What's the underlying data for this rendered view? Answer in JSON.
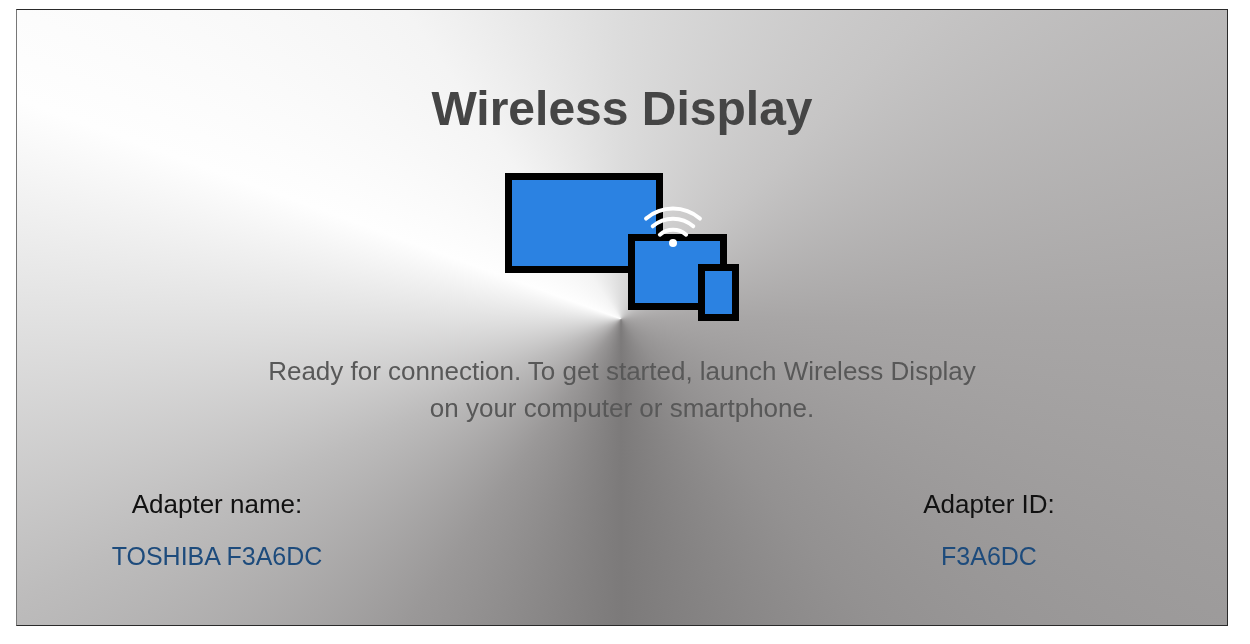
{
  "title": "Wireless Display",
  "message": "Ready for connection. To get started, launch Wireless Display on your computer or smartphone.",
  "adapter_name": {
    "label": "Adapter name:",
    "value": "TOSHIBA F3A6DC"
  },
  "adapter_id": {
    "label": "Adapter ID:",
    "value": "F3A6DC"
  }
}
